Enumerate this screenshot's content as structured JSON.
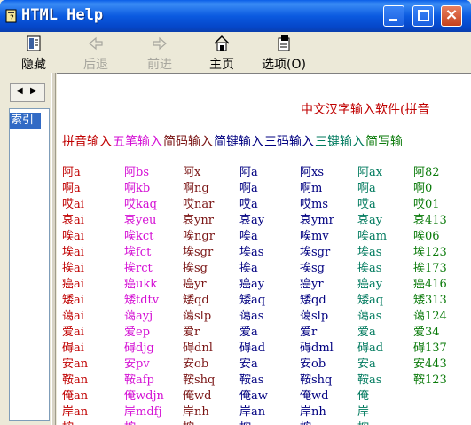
{
  "window": {
    "title": "HTML Help"
  },
  "toolbar": {
    "hide": "隐藏",
    "back": "后退",
    "forward": "前进",
    "home": "主页",
    "options": "选项(O)"
  },
  "leftpane": {
    "index_tab": "索引"
  },
  "content": {
    "headline": "中文汉字输入软件(拼音",
    "column_headers": [
      "拼音输入",
      "五笔输入",
      "简码输入",
      "简键输入",
      "三码输入",
      "三键输入",
      "简写输"
    ],
    "header_colors": [
      "#c00000",
      "#d40fd4",
      "#7a1515",
      "#000080",
      "#000080",
      "#007a5e",
      "#0a7a0a"
    ],
    "rows": [
      [
        "阿a",
        "阿bs",
        "阿x",
        "阿a",
        "阿xs",
        "阿ax",
        "阿82"
      ],
      [
        "啊a",
        "啊kb",
        "啊ng",
        "啊a",
        "啊m",
        "啊a",
        "啊0"
      ],
      [
        "哎ai",
        "哎kaq",
        "哎nar",
        "哎a",
        "哎ms",
        "哎a",
        "哎01"
      ],
      [
        "哀ai",
        "哀yeu",
        "哀ynr",
        "哀ay",
        "哀ymr",
        "哀ay",
        "哀413"
      ],
      [
        "唉ai",
        "唉kct",
        "唉ngr",
        "唉a",
        "唉mv",
        "唉am",
        "唉06"
      ],
      [
        "埃ai",
        "埃fct",
        "埃sgr",
        "埃as",
        "埃sgr",
        "埃as",
        "埃123"
      ],
      [
        "挨ai",
        "挨rct",
        "挨sg",
        "挨a",
        "挨sg",
        "挨as",
        "挨173"
      ],
      [
        "癌ai",
        "癌ukk",
        "癌yr",
        "癌ay",
        "癌yr",
        "癌ay",
        "癌416"
      ],
      [
        "矮ai",
        "矮tdtv",
        "矮qd",
        "矮aq",
        "矮qd",
        "矮aq",
        "矮313"
      ],
      [
        "蔼ai",
        "蔼ayj",
        "蔼slp",
        "蔼as",
        "蔼slp",
        "蔼as",
        "蔼124"
      ],
      [
        "爱ai",
        "爱ep",
        "爱r",
        "爱a",
        "爱r",
        "爱a",
        "爱34"
      ],
      [
        "碍ai",
        "碍djg",
        "碍dnl",
        "碍ad",
        "碍dml",
        "碍ad",
        "碍137"
      ],
      [
        "安an",
        "安pv",
        "安ob",
        "安a",
        "安ob",
        "安a",
        "安443"
      ],
      [
        "鞍an",
        "鞍afp",
        "鞍shq",
        "鞍as",
        "鞍shq",
        "鞍as",
        "鞍123"
      ],
      [
        "俺an",
        "俺wdjn",
        "俺wd",
        "俺aw",
        "俺wd",
        "俺",
        ""
      ],
      [
        "岸an",
        "岸mdfj",
        "岸nh",
        "岸an",
        "岸nh",
        "岸",
        ""
      ],
      [
        "按an",
        "按rpv",
        "按so",
        "按a",
        "按so",
        "按",
        ""
      ]
    ]
  }
}
